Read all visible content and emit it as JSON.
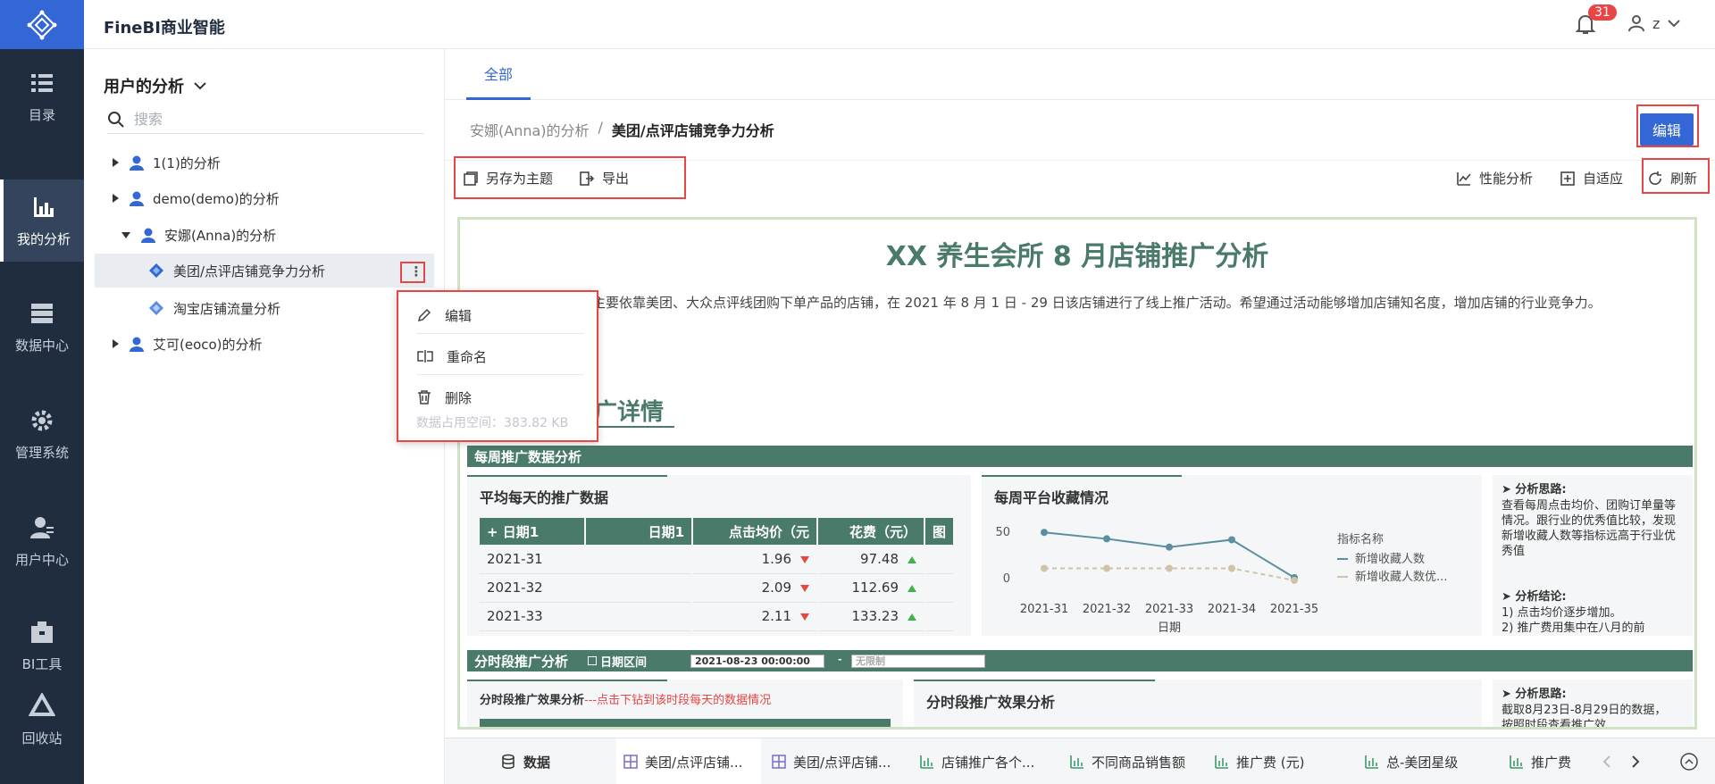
{
  "app": {
    "title": "FineBI商业智能",
    "notification_count": "31",
    "user_initial": "z"
  },
  "nav": {
    "items": [
      {
        "label": "目录"
      },
      {
        "label": "我的分析"
      },
      {
        "label": "数据中心"
      },
      {
        "label": "管理系统"
      },
      {
        "label": "用户中心"
      },
      {
        "label": "BI工具"
      },
      {
        "label": "回收站"
      }
    ]
  },
  "side": {
    "title": "用户的分析",
    "search_placeholder": "搜索",
    "tree": [
      {
        "label": "1(1)的分析"
      },
      {
        "label": "demo(demo)的分析"
      },
      {
        "label": "安娜(Anna)的分析"
      },
      {
        "label": "美团/点评店铺竞争力分析"
      },
      {
        "label": "淘宝店铺流量分析"
      },
      {
        "label": "艾可(eoco)的分析"
      }
    ],
    "more_label": "⋮"
  },
  "context_menu": {
    "items": [
      {
        "label": "编辑"
      },
      {
        "label": "重命名"
      },
      {
        "label": "删除"
      }
    ],
    "footer": "数据占用空间：383.82 KB"
  },
  "main": {
    "tab_all": "全部",
    "breadcrumb": {
      "parent": "安娜(Anna)的分析",
      "sep": "/",
      "current": "美团/点评店铺竞争力分析"
    },
    "edit_label": "编辑",
    "toolbar": {
      "save_as_theme": "另存为主题",
      "export": "导出",
      "performance": "性能分析",
      "adaptive": "自适应",
      "refresh": "刷新"
    }
  },
  "dashboard": {
    "title": "XX 养生会所 8 月店铺推广分析",
    "description": "主要依靠美团、大众点评线团购下单产品的店铺，在 2021 年 8 月 1 日 - 29 日该店铺进行了线上推广活动。希望通过活动能够增加店铺知名度，增加店铺的行业竞争力。",
    "subtitle": "广详情",
    "section1_title": "每周推广数据分析",
    "panel_avg_title": "平均每天的推广数据",
    "table": {
      "headers": [
        "+ 日期1",
        "日期1",
        "点击均价（元",
        "花费（元）",
        "图"
      ],
      "rows": [
        {
          "week": "2021-31",
          "price": "1.96",
          "price_trend": "down",
          "cost": "97.48",
          "cost_trend": "up"
        },
        {
          "week": "2021-32",
          "price": "2.09",
          "price_trend": "down",
          "cost": "112.69",
          "cost_trend": "up"
        },
        {
          "week": "2021-33",
          "price": "2.11",
          "price_trend": "down",
          "cost": "133.23",
          "cost_trend": "up"
        }
      ]
    },
    "panel_fav_title": "每周平台收藏情况",
    "legend_title": "指标名称",
    "analysis_notes": {
      "heading1": "➤ 分析思路:",
      "text1": "查看每周点击均价、团购订单量等情况。跟行业的优秀值比较，发现新增收藏人数等指标远高于行业优秀值",
      "heading2": "➤ 分析结论:",
      "text2": "1) 点击均价逐步增加。",
      "text3": "2) 推广费用集中在八月的前"
    },
    "section2_title": "分时段推广分析",
    "date_label": "日期区间",
    "date_start": "2021-08-23 00:00:00",
    "date_sep": "-",
    "date_end_placeholder": "无限制",
    "panel_period_title": "分时段推广效果分析",
    "panel_period_hint": "---点击下钻到该时段每天的数据情况",
    "panel_period2_title": "分时段推广效果分析",
    "analysis2_heading": "➤ 分析思路:",
    "analysis2_text": "截取8月23日-8月29日的数据，按照时段查看推广效"
  },
  "chart_data": {
    "type": "line",
    "categories": [
      "2021-31",
      "2021-32",
      "2021-33",
      "2021-34",
      "2021-35"
    ],
    "series": [
      {
        "name": "新增收藏人数",
        "values": [
          49,
          42,
          33,
          41,
          0
        ],
        "color": "#5b8fa0",
        "style": "solid"
      },
      {
        "name": "新增收藏人数优...",
        "values": [
          10,
          10,
          10,
          10,
          -3
        ],
        "color": "#cfc4a8",
        "style": "dashed"
      }
    ],
    "xlabel": "日期",
    "ylabel": "",
    "yticks": [
      "50",
      "0"
    ],
    "ylim": [
      -5,
      55
    ],
    "legend_position": "right"
  },
  "bottom_tabs": [
    {
      "label": "数据"
    },
    {
      "label": "美团/点评店铺..."
    },
    {
      "label": "美团/点评店铺..."
    },
    {
      "label": "店铺推广各个..."
    },
    {
      "label": "不同商品销售额"
    },
    {
      "label": "推广费 (元)"
    },
    {
      "label": "总-美团星级"
    },
    {
      "label": "推广费"
    }
  ],
  "colors": {
    "brand": "#3367d6",
    "nav_bg": "#1f2d3f",
    "dash_green": "#4a7a6a",
    "highlight": "#e84545"
  }
}
